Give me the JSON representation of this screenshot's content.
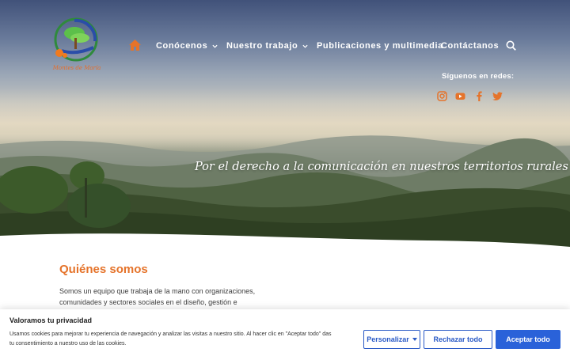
{
  "logo": {
    "text": "Montes de María",
    "icon": "tree-logo-icon"
  },
  "nav": {
    "home_icon": "home-icon",
    "items": [
      {
        "label": "Conócenos",
        "has_dropdown": true
      },
      {
        "label": "Nuestro trabajo",
        "has_dropdown": true
      },
      {
        "label": "Publicaciones y multimedia",
        "has_dropdown": false
      },
      {
        "label": "Contáctanos",
        "has_dropdown": false
      }
    ],
    "search_icon": "search-icon"
  },
  "social": {
    "label": "Síguenos en redes:",
    "icons": [
      "instagram-icon",
      "youtube-icon",
      "facebook-icon",
      "twitter-icon"
    ]
  },
  "hero": {
    "tagline": "Por el derecho a la comunicación en nuestros territorios rurales"
  },
  "about": {
    "title": "Quiénes somos",
    "lines": [
      "Somos un equipo que trabaja de la mano con organizaciones,",
      "comunidades y sectores sociales en el diseño, gestión e"
    ]
  },
  "cookie": {
    "title": "Valoramos tu privacidad",
    "text": "Usamos cookies para mejorar tu experiencia de navegación y analizar las visitas a nuestro sitio. Al hacer clic en \"Aceptar todo\" das tu consentimiento a nuestro uso de las cookies.",
    "customize": "Personalizar",
    "reject": "Rechazar todo",
    "accept": "Aceptar todo"
  },
  "colors": {
    "accent": "#e5732a",
    "button_blue": "#2a62d9",
    "nav_active": "#e5732a"
  }
}
